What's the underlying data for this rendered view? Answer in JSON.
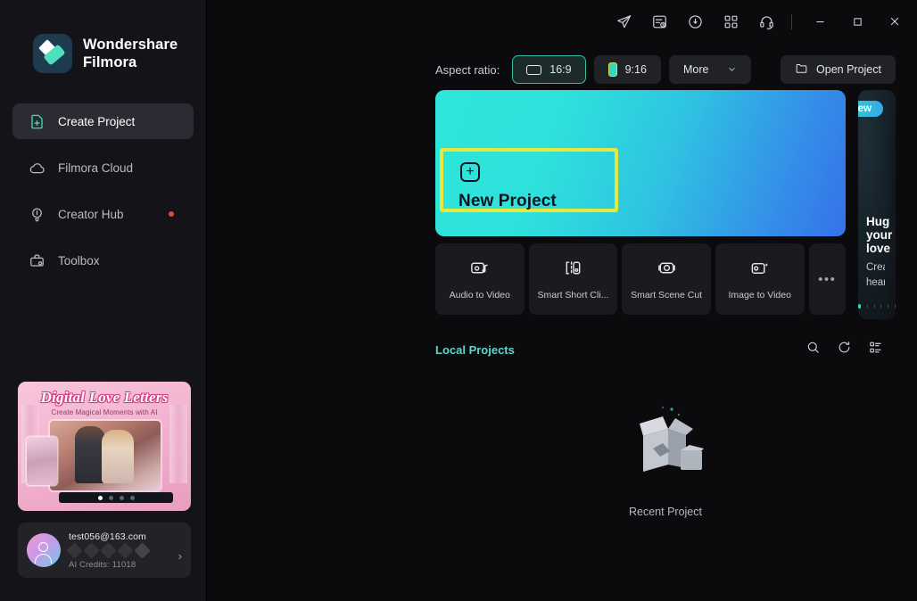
{
  "app": {
    "brand_name": "Wondershare\nFilmora"
  },
  "titlebar": {
    "icons": [
      {
        "name": "send-feedback-icon",
        "label": "paper-plane"
      },
      {
        "name": "task-list-icon",
        "label": "task-list"
      },
      {
        "name": "cloud-download-icon",
        "label": "cloud-download"
      },
      {
        "name": "apps-grid-icon",
        "label": "apps-grid"
      },
      {
        "name": "headset-support-icon",
        "label": "headset"
      }
    ],
    "window_controls": {
      "minimize": "—",
      "maximize": "□",
      "close": "✕"
    }
  },
  "sidebar": {
    "items": [
      {
        "label": "Create Project",
        "icon": "new-file-plus-icon",
        "active": true,
        "dot": false
      },
      {
        "label": "Filmora Cloud",
        "icon": "cloud-icon",
        "active": false,
        "dot": false
      },
      {
        "label": "Creator Hub",
        "icon": "lightbulb-icon",
        "active": false,
        "dot": true
      },
      {
        "label": "Toolbox",
        "icon": "toolbox-icon",
        "active": false,
        "dot": false
      }
    ],
    "promo": {
      "title": "Digital Love Letters",
      "subtitle": "Create Magical Moments with AI",
      "dots": 4,
      "active_dot": 1
    },
    "account": {
      "email": "test056@163.com",
      "credits": "AI Credits: 11018",
      "badge_count": 5,
      "chevron": "›"
    }
  },
  "toolbar": {
    "aspect_label": "Aspect ratio:",
    "chips": [
      {
        "label": "16:9",
        "icon": "landscape-frame-icon",
        "selected": true
      },
      {
        "label": "9:16",
        "icon": "portrait-frame-icon",
        "selected": false
      }
    ],
    "more_label": "More",
    "more_caret": "⌄",
    "open_project_label": "Open Project",
    "open_project_icon": "folder-icon"
  },
  "hero": {
    "label": "New Project",
    "plus": "+",
    "gradient_start": "#2ee6da",
    "gradient_end": "#3671e9",
    "highlight_color": "#e8e83a"
  },
  "tools": [
    {
      "label": "Audio to Video",
      "icon": "audio-to-video-icon"
    },
    {
      "label": "Smart Short Cli...",
      "icon": "smart-short-clip-icon"
    },
    {
      "label": "Smart Scene Cut",
      "icon": "smart-scene-cut-icon"
    },
    {
      "label": "Image to Video",
      "icon": "image-to-video-icon"
    },
    {
      "label": "•••",
      "icon": "more-tools-icon"
    }
  ],
  "promo_card": {
    "badge": "New",
    "title": "Hug your love",
    "description": "Create heartwarming AI hugs that capture precious moments.",
    "dots": 6,
    "active_dot": 0,
    "accent": "#2fd9bf"
  },
  "local_projects": {
    "title": "Local Projects",
    "title_color": "#5fd6c6",
    "actions": [
      {
        "name": "search-icon"
      },
      {
        "name": "refresh-icon"
      },
      {
        "name": "list-view-icon"
      }
    ],
    "empty_caption": "Recent Project"
  }
}
